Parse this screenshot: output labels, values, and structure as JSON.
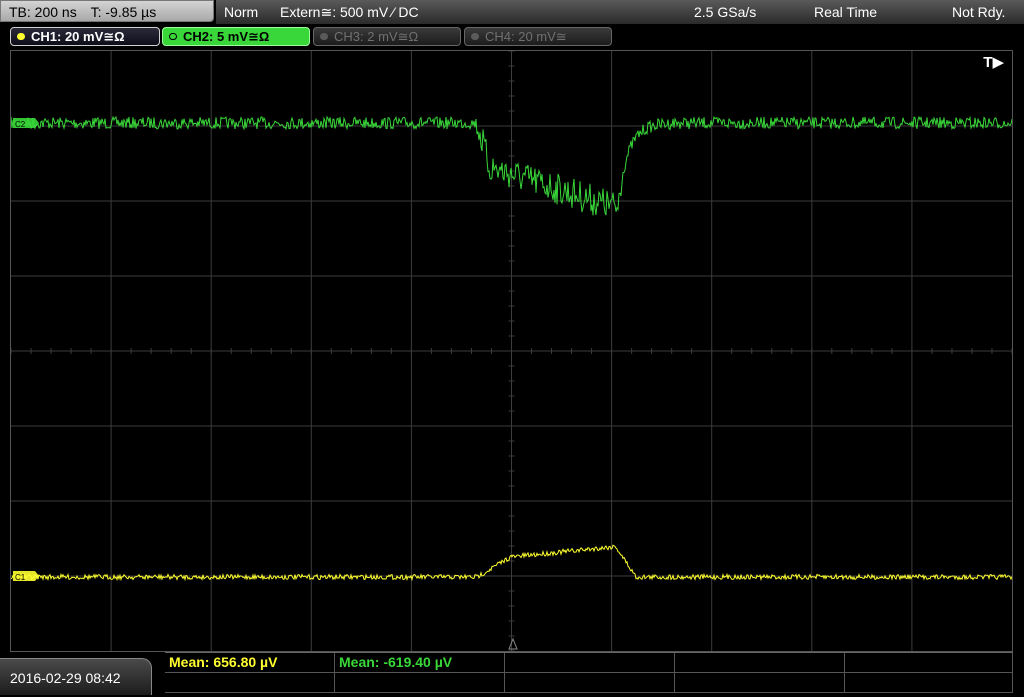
{
  "topbar": {
    "timebase": "TB: 200 ns",
    "trigger_time": "T: -9.85 µs",
    "mode": "Norm",
    "trigger_source": "Extern≅: 500 mV ⁄ DC",
    "sample_rate": "2.5 GSa/s",
    "acq_mode": "Real Time",
    "status": "Not Rdy."
  },
  "channels": [
    {
      "label": "CH1: 20 mV≅Ω",
      "state": "on",
      "color": "#ffff30"
    },
    {
      "label": "CH2: 5 mV≅Ω",
      "state": "selected",
      "color": "#39d739"
    },
    {
      "label": "CH3: 2 mV≅Ω",
      "state": "off"
    },
    {
      "label": "CH4: 20 mV≅",
      "state": "off"
    }
  ],
  "screen": {
    "trigger_marker": "T▶",
    "ch1_marker": "C1",
    "ch2_marker": "C2"
  },
  "bottombar": {
    "datetime": "2016-02-29 08:42",
    "measurements": [
      {
        "label": "Mean: 656.80 µV",
        "color": "#ffff30"
      },
      {
        "label": "Mean: -619.40 µV",
        "color": "#39d739"
      }
    ]
  },
  "colors": {
    "ch1": "#ffff30",
    "ch2": "#39d739",
    "grid": "#3c3c3c"
  }
}
